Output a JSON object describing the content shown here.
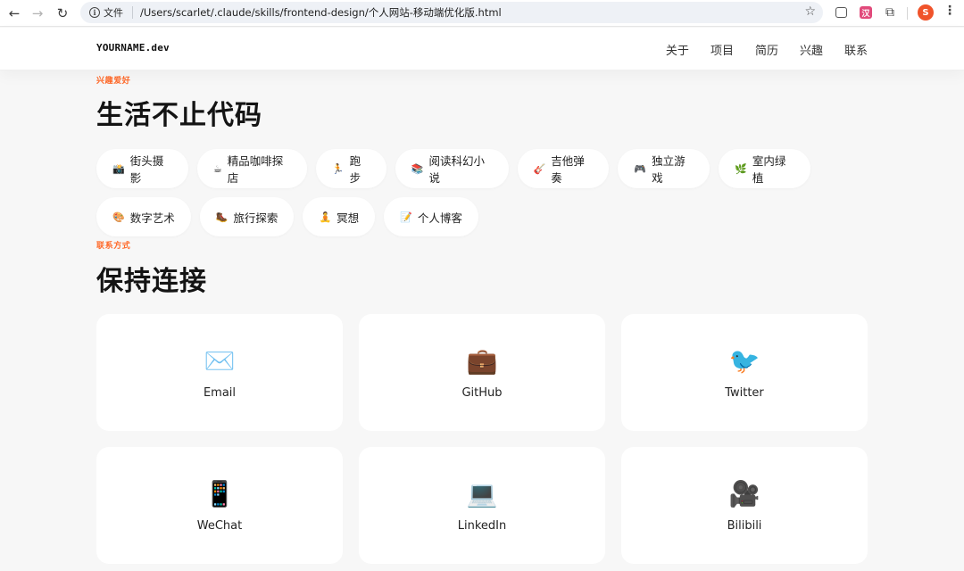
{
  "browser": {
    "url_badge": "文件",
    "url": "/Users/scarlet/.claude/skills/frontend-design/个人网站-移动端优化版.html",
    "profile_initial": "S",
    "extension_letter": "汉"
  },
  "header": {
    "logo": "YOURNAME.dev",
    "nav": [
      "关于",
      "项目",
      "简历",
      "兴趣",
      "联系"
    ]
  },
  "interests": {
    "label": "兴趣爱好",
    "title": "生活不止代码",
    "chips": [
      {
        "icon": "📸",
        "label": "街头摄影"
      },
      {
        "icon": "☕",
        "label": "精品咖啡探店"
      },
      {
        "icon": "🏃",
        "label": "跑步"
      },
      {
        "icon": "📚",
        "label": "阅读科幻小说"
      },
      {
        "icon": "🎸",
        "label": "吉他弹奏"
      },
      {
        "icon": "🎮",
        "label": "独立游戏"
      },
      {
        "icon": "🌿",
        "label": "室内绿植"
      },
      {
        "icon": "🎨",
        "label": "数字艺术"
      },
      {
        "icon": "🥾",
        "label": "旅行探索"
      },
      {
        "icon": "🧘",
        "label": "冥想"
      },
      {
        "icon": "📝",
        "label": "个人博客"
      }
    ]
  },
  "contact": {
    "label": "联系方式",
    "title": "保持连接",
    "cards": [
      {
        "icon": "✉️",
        "label": "Email"
      },
      {
        "icon": "💼",
        "label": "GitHub"
      },
      {
        "icon": "🐦",
        "label": "Twitter"
      },
      {
        "icon": "📱",
        "label": "WeChat"
      },
      {
        "icon": "💻",
        "label": "LinkedIn"
      },
      {
        "icon": "🎥",
        "label": "Bilibili"
      }
    ]
  }
}
